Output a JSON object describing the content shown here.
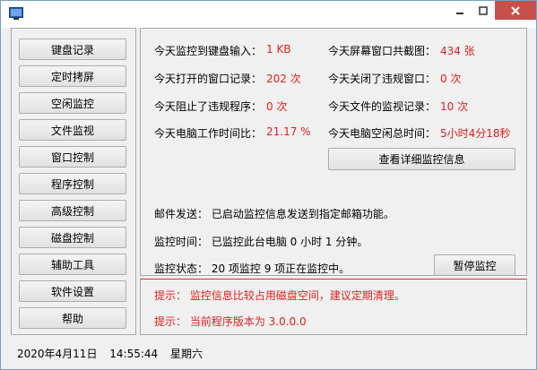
{
  "nav": [
    "键盘记录",
    "定时拷屏",
    "空闲监控",
    "文件监视",
    "窗口控制",
    "程序控制",
    "高级控制",
    "磁盘控制",
    "辅助工具",
    "软件设置",
    "帮助"
  ],
  "stats": {
    "keyboard_label": "今天监控到键盘输入：",
    "keyboard_value": "1 KB",
    "screenshot_label": "今天屏幕窗口共截图：",
    "screenshot_value": "434 张",
    "opened_label": "今天打开的窗口记录：",
    "opened_value": "202 次",
    "closed_label": "今天关闭了违规窗口：",
    "closed_value": "0 次",
    "blocked_label": "今天阻止了违规程序：",
    "blocked_value": "0 次",
    "files_label": "今天文件的监视记录：",
    "files_value": "10 次",
    "worktime_label": "今天电脑工作时间比：",
    "worktime_value": "21.17 %",
    "idle_label": "今天电脑空闲总时间：",
    "idle_value": "5小时4分18秒"
  },
  "detail_button": "查看详细监控信息",
  "mail": "邮件发送：  已启动监控信息发送到指定邮箱功能。",
  "monitor_time": "监控时间：  已监控此台电脑 0 小时 1 分钟。",
  "monitor_status": "监控状态：  20 项监控 9 项正在监控中。",
  "pause_button": "暂停监控",
  "tips": [
    "提示：  监控信息比较占用磁盘空间，建议定期清理。",
    "提示：  当前程序版本为 3.0.0.0"
  ],
  "status": {
    "date": "2020年4月11日",
    "time": "14:55:44",
    "weekday": "星期六"
  }
}
